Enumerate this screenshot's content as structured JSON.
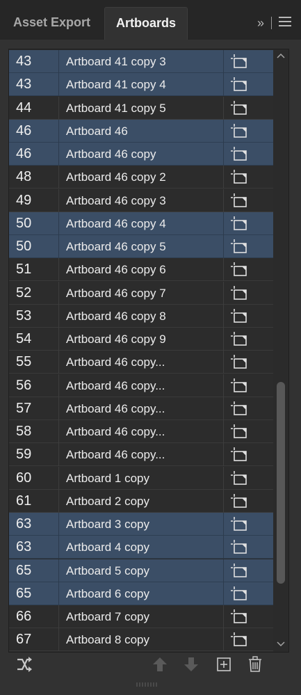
{
  "tabs": [
    {
      "label": "Asset Export",
      "active": false
    },
    {
      "label": "Artboards",
      "active": true
    }
  ],
  "panel_tools": {
    "expand_glyph": "»",
    "menu_icon": "menu-icon"
  },
  "colors": {
    "selected_row": "#3b4e66",
    "row": "#2c2c2c",
    "panel_bg": "#323232",
    "tab_bar": "#262626"
  },
  "artboards": [
    {
      "num": "43",
      "name": "Artboard 41 copy 3",
      "selected": true
    },
    {
      "num": "43",
      "name": "Artboard 41 copy 4",
      "selected": true
    },
    {
      "num": "44",
      "name": "Artboard 41 copy 5",
      "selected": false
    },
    {
      "num": "46",
      "name": "Artboard 46",
      "selected": true
    },
    {
      "num": "46",
      "name": "Artboard 46 copy",
      "selected": true
    },
    {
      "num": "48",
      "name": "Artboard 46 copy 2",
      "selected": false
    },
    {
      "num": "49",
      "name": "Artboard 46 copy 3",
      "selected": false
    },
    {
      "num": "50",
      "name": "Artboard 46 copy 4",
      "selected": true
    },
    {
      "num": "50",
      "name": "Artboard 46 copy 5",
      "selected": true
    },
    {
      "num": "51",
      "name": "Artboard 46 copy 6",
      "selected": false
    },
    {
      "num": "52",
      "name": "Artboard 46 copy 7",
      "selected": false
    },
    {
      "num": "53",
      "name": "Artboard 46 copy 8",
      "selected": false
    },
    {
      "num": "54",
      "name": "Artboard 46 copy 9",
      "selected": false
    },
    {
      "num": "55",
      "name": "Artboard 46 copy...",
      "selected": false
    },
    {
      "num": "56",
      "name": "Artboard 46 copy...",
      "selected": false
    },
    {
      "num": "57",
      "name": "Artboard 46 copy...",
      "selected": false
    },
    {
      "num": "58",
      "name": "Artboard 46 copy...",
      "selected": false
    },
    {
      "num": "59",
      "name": "Artboard 46 copy...",
      "selected": false
    },
    {
      "num": "60",
      "name": "Artboard 1 copy",
      "selected": false
    },
    {
      "num": "61",
      "name": "Artboard 2 copy",
      "selected": false
    },
    {
      "num": "63",
      "name": "Artboard 3 copy",
      "selected": true
    },
    {
      "num": "63",
      "name": "Artboard 4 copy",
      "selected": true
    },
    {
      "num": "65",
      "name": "Artboard 5 copy",
      "selected": true
    },
    {
      "num": "65",
      "name": "Artboard 6 copy",
      "selected": true
    },
    {
      "num": "66",
      "name": "Artboard 7 copy",
      "selected": false
    },
    {
      "num": "67",
      "name": "Artboard 8 copy",
      "selected": false
    }
  ],
  "row_icon": "artboard-options-icon",
  "bottom_toolbar": [
    {
      "name": "rearrange-artboards-icon",
      "enabled": true
    },
    {
      "name": "move-up-icon",
      "enabled": false
    },
    {
      "name": "move-down-icon",
      "enabled": false
    },
    {
      "name": "new-artboard-icon",
      "enabled": true
    },
    {
      "name": "delete-artboard-icon",
      "enabled": true
    }
  ]
}
